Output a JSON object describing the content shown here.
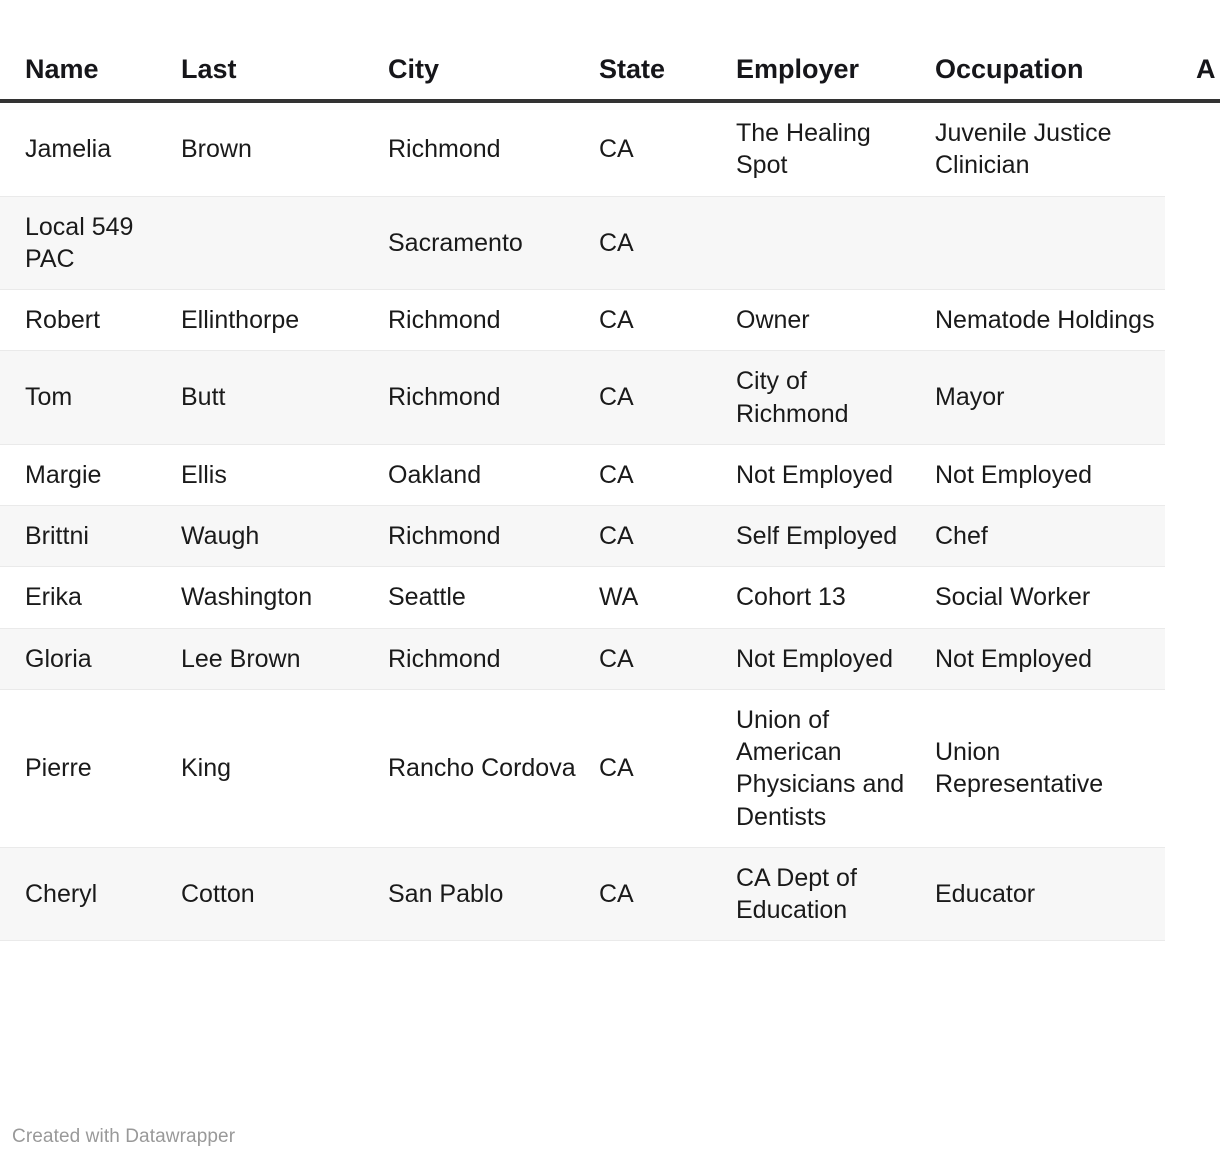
{
  "footer": {
    "credit": "Created with Datawrapper"
  },
  "table": {
    "columns": [
      {
        "key": "name",
        "label": "Name"
      },
      {
        "key": "last",
        "label": "Last"
      },
      {
        "key": "city",
        "label": "City"
      },
      {
        "key": "state",
        "label": "State"
      },
      {
        "key": "employer",
        "label": "Employer"
      },
      {
        "key": "occupation",
        "label": "Occupation"
      },
      {
        "key": "amount",
        "label": "A"
      }
    ],
    "rows": [
      {
        "name": "Jamelia",
        "last": "Brown",
        "city": "Richmond",
        "state": "CA",
        "employer": "The Healing Spot",
        "occupation": "Juvenile Justice Clinician",
        "amount": "",
        "heat_color": "#27508f"
      },
      {
        "name": "Local 549 PAC",
        "last": "",
        "city": "Sacramento",
        "state": "CA",
        "employer": "",
        "occupation": "",
        "amount": "",
        "heat_color": "#27508f"
      },
      {
        "name": "Robert",
        "last": "Ellinthorpe",
        "city": "Richmond",
        "state": "CA",
        "employer": "Owner",
        "occupation": "Nematode Holdings",
        "amount": "",
        "heat_color": "#d7eed2"
      },
      {
        "name": "Tom",
        "last": "Butt",
        "city": "Richmond",
        "state": "CA",
        "employer": "City of Richmond",
        "occupation": "Mayor",
        "amount": "",
        "heat_color": "#d7eed2"
      },
      {
        "name": "Margie",
        "last": "Ellis",
        "city": "Oakland",
        "state": "CA",
        "employer": "Not Employed",
        "occupation": "Not Employed",
        "amount": "",
        "heat_color": "#eaf6e5"
      },
      {
        "name": "Brittni",
        "last": "Waugh",
        "city": "Richmond",
        "state": "CA",
        "employer": "Self Employed",
        "occupation": "Chef",
        "amount": "",
        "heat_color": "#edf7e9"
      },
      {
        "name": "Erika",
        "last": "Washington",
        "city": "Seattle",
        "state": "WA",
        "employer": "Cohort 13",
        "occupation": "Social Worker",
        "amount": "",
        "heat_color": "#edf7e9"
      },
      {
        "name": "Gloria",
        "last": "Lee Brown",
        "city": "Richmond",
        "state": "CA",
        "employer": "Not Employed",
        "occupation": "Not Employed",
        "amount": "",
        "heat_color": "#edf7e9"
      },
      {
        "name": "Pierre",
        "last": "King",
        "city": "Rancho Cordova",
        "state": "CA",
        "employer": "Union of American Physicians and Dentists",
        "occupation": "Union Representative",
        "amount": "",
        "heat_color": "#edf7e9"
      },
      {
        "name": "Cheryl",
        "last": "Cotton",
        "city": "San Pablo",
        "state": "CA",
        "employer": "CA Dept of Education",
        "occupation": "Educator",
        "amount": "",
        "heat_color": "#edf7e9"
      }
    ]
  },
  "style": {
    "header_rule_color": "#333333",
    "row_alt_color": "#f7f7f7",
    "row_border_color": "#eaeaea",
    "credit_color": "#999999"
  }
}
